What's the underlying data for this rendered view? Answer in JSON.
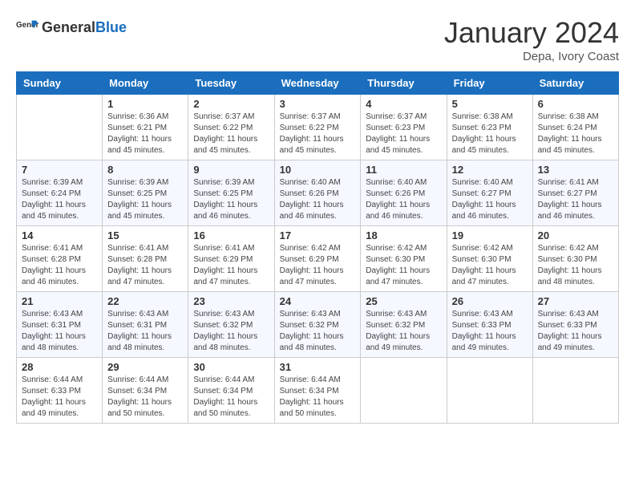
{
  "header": {
    "logo_general": "General",
    "logo_blue": "Blue",
    "month_title": "January 2024",
    "location": "Depa, Ivory Coast"
  },
  "days_of_week": [
    "Sunday",
    "Monday",
    "Tuesday",
    "Wednesday",
    "Thursday",
    "Friday",
    "Saturday"
  ],
  "weeks": [
    [
      {
        "day": "",
        "sunrise": "",
        "sunset": "",
        "daylight": ""
      },
      {
        "day": "1",
        "sunrise": "6:36 AM",
        "sunset": "6:21 PM",
        "daylight": "11 hours and 45 minutes."
      },
      {
        "day": "2",
        "sunrise": "6:37 AM",
        "sunset": "6:22 PM",
        "daylight": "11 hours and 45 minutes."
      },
      {
        "day": "3",
        "sunrise": "6:37 AM",
        "sunset": "6:22 PM",
        "daylight": "11 hours and 45 minutes."
      },
      {
        "day": "4",
        "sunrise": "6:37 AM",
        "sunset": "6:23 PM",
        "daylight": "11 hours and 45 minutes."
      },
      {
        "day": "5",
        "sunrise": "6:38 AM",
        "sunset": "6:23 PM",
        "daylight": "11 hours and 45 minutes."
      },
      {
        "day": "6",
        "sunrise": "6:38 AM",
        "sunset": "6:24 PM",
        "daylight": "11 hours and 45 minutes."
      }
    ],
    [
      {
        "day": "7",
        "sunrise": "6:39 AM",
        "sunset": "6:24 PM",
        "daylight": "11 hours and 45 minutes."
      },
      {
        "day": "8",
        "sunrise": "6:39 AM",
        "sunset": "6:25 PM",
        "daylight": "11 hours and 45 minutes."
      },
      {
        "day": "9",
        "sunrise": "6:39 AM",
        "sunset": "6:25 PM",
        "daylight": "11 hours and 46 minutes."
      },
      {
        "day": "10",
        "sunrise": "6:40 AM",
        "sunset": "6:26 PM",
        "daylight": "11 hours and 46 minutes."
      },
      {
        "day": "11",
        "sunrise": "6:40 AM",
        "sunset": "6:26 PM",
        "daylight": "11 hours and 46 minutes."
      },
      {
        "day": "12",
        "sunrise": "6:40 AM",
        "sunset": "6:27 PM",
        "daylight": "11 hours and 46 minutes."
      },
      {
        "day": "13",
        "sunrise": "6:41 AM",
        "sunset": "6:27 PM",
        "daylight": "11 hours and 46 minutes."
      }
    ],
    [
      {
        "day": "14",
        "sunrise": "6:41 AM",
        "sunset": "6:28 PM",
        "daylight": "11 hours and 46 minutes."
      },
      {
        "day": "15",
        "sunrise": "6:41 AM",
        "sunset": "6:28 PM",
        "daylight": "11 hours and 47 minutes."
      },
      {
        "day": "16",
        "sunrise": "6:41 AM",
        "sunset": "6:29 PM",
        "daylight": "11 hours and 47 minutes."
      },
      {
        "day": "17",
        "sunrise": "6:42 AM",
        "sunset": "6:29 PM",
        "daylight": "11 hours and 47 minutes."
      },
      {
        "day": "18",
        "sunrise": "6:42 AM",
        "sunset": "6:30 PM",
        "daylight": "11 hours and 47 minutes."
      },
      {
        "day": "19",
        "sunrise": "6:42 AM",
        "sunset": "6:30 PM",
        "daylight": "11 hours and 47 minutes."
      },
      {
        "day": "20",
        "sunrise": "6:42 AM",
        "sunset": "6:30 PM",
        "daylight": "11 hours and 48 minutes."
      }
    ],
    [
      {
        "day": "21",
        "sunrise": "6:43 AM",
        "sunset": "6:31 PM",
        "daylight": "11 hours and 48 minutes."
      },
      {
        "day": "22",
        "sunrise": "6:43 AM",
        "sunset": "6:31 PM",
        "daylight": "11 hours and 48 minutes."
      },
      {
        "day": "23",
        "sunrise": "6:43 AM",
        "sunset": "6:32 PM",
        "daylight": "11 hours and 48 minutes."
      },
      {
        "day": "24",
        "sunrise": "6:43 AM",
        "sunset": "6:32 PM",
        "daylight": "11 hours and 48 minutes."
      },
      {
        "day": "25",
        "sunrise": "6:43 AM",
        "sunset": "6:32 PM",
        "daylight": "11 hours and 49 minutes."
      },
      {
        "day": "26",
        "sunrise": "6:43 AM",
        "sunset": "6:33 PM",
        "daylight": "11 hours and 49 minutes."
      },
      {
        "day": "27",
        "sunrise": "6:43 AM",
        "sunset": "6:33 PM",
        "daylight": "11 hours and 49 minutes."
      }
    ],
    [
      {
        "day": "28",
        "sunrise": "6:44 AM",
        "sunset": "6:33 PM",
        "daylight": "11 hours and 49 minutes."
      },
      {
        "day": "29",
        "sunrise": "6:44 AM",
        "sunset": "6:34 PM",
        "daylight": "11 hours and 50 minutes."
      },
      {
        "day": "30",
        "sunrise": "6:44 AM",
        "sunset": "6:34 PM",
        "daylight": "11 hours and 50 minutes."
      },
      {
        "day": "31",
        "sunrise": "6:44 AM",
        "sunset": "6:34 PM",
        "daylight": "11 hours and 50 minutes."
      },
      {
        "day": "",
        "sunrise": "",
        "sunset": "",
        "daylight": ""
      },
      {
        "day": "",
        "sunrise": "",
        "sunset": "",
        "daylight": ""
      },
      {
        "day": "",
        "sunrise": "",
        "sunset": "",
        "daylight": ""
      }
    ]
  ]
}
